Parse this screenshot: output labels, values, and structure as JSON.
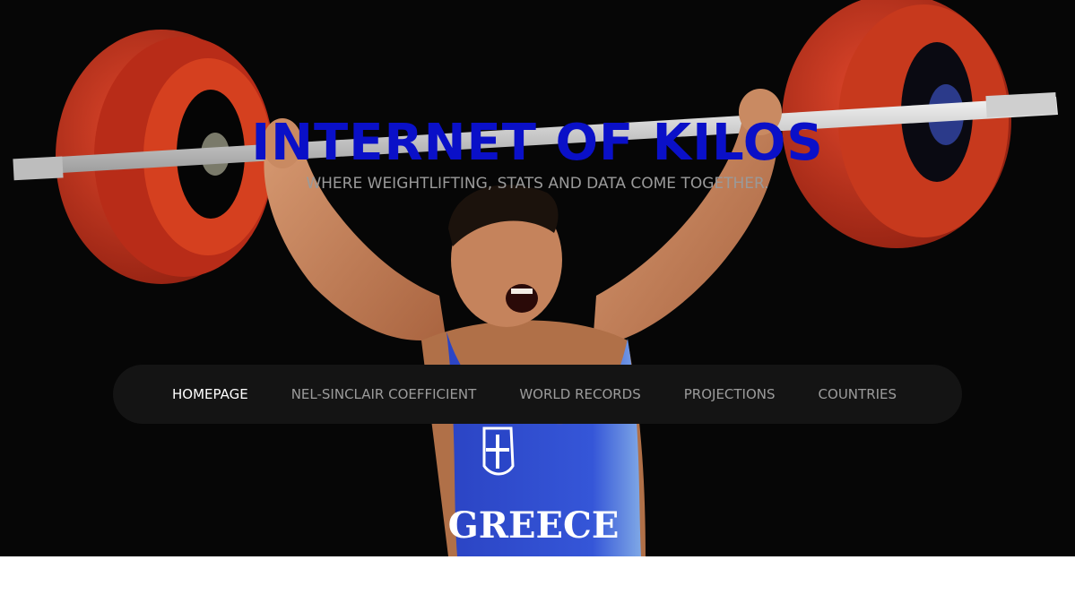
{
  "header": {
    "title": "INTERNET OF KILOS",
    "tagline": "WHERE WEIGHTLIFTING, STATS AND DATA COME TOGETHER."
  },
  "nav": {
    "items": [
      {
        "label": "HOMEPAGE",
        "active": true
      },
      {
        "label": "NEL-SINCLAIR COEFFICIENT",
        "active": false
      },
      {
        "label": "WORLD RECORDS",
        "active": false
      },
      {
        "label": "PROJECTIONS",
        "active": false
      },
      {
        "label": "COUNTRIES",
        "active": false
      }
    ]
  },
  "hero": {
    "image_subject": "weightlifter-overhead-barbell",
    "singlet_text": "GREECE"
  },
  "colors": {
    "title": "#0a10c8",
    "tagline": "#9a9a9a",
    "nav_bg": "#141414",
    "nav_text": "#9c9c9c",
    "nav_active": "#ffffff",
    "plate_red": "#c8321c",
    "singlet_blue": "#2f4fd0"
  }
}
